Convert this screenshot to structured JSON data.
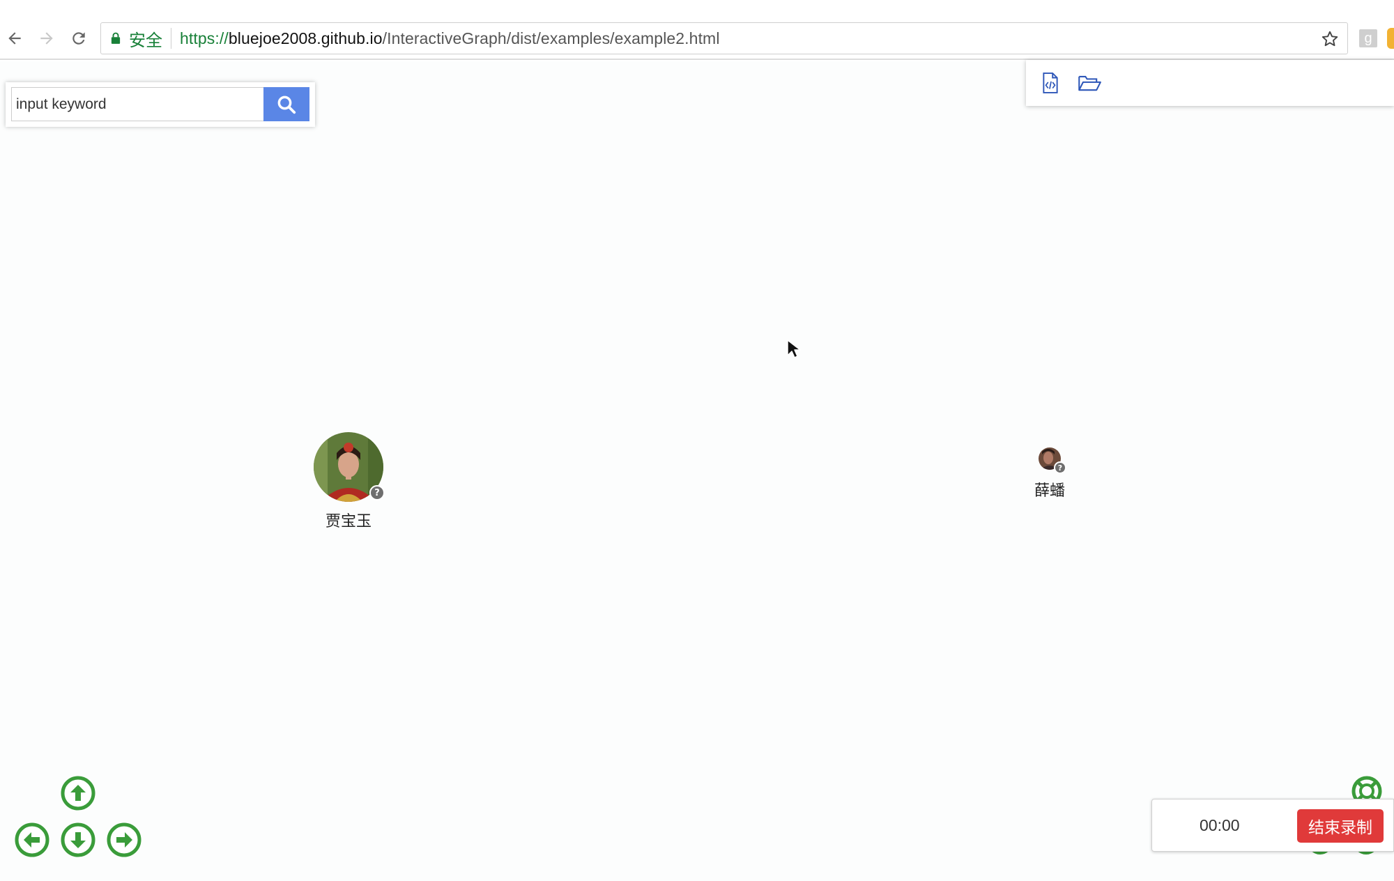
{
  "browser": {
    "back_icon": "back-arrow-icon",
    "forward_icon": "forward-arrow-icon",
    "reload_icon": "reload-icon",
    "security_label": "安全",
    "url_scheme": "https://",
    "url_host": "bluejoe2008.github.io",
    "url_path": "/InteractiveGraph/dist/examples/example2.html",
    "bookmark_icon": "star-icon",
    "extension_label": "g"
  },
  "search": {
    "placeholder": "input keyword",
    "value": "",
    "button_icon": "search-icon"
  },
  "toolbar": {
    "items": [
      "export-source-icon",
      "open-folder-icon"
    ]
  },
  "graph": {
    "nodes": [
      {
        "label": "贾宝玉",
        "badge": "?"
      },
      {
        "label": "薛蟠",
        "badge": "?"
      }
    ]
  },
  "controls": {
    "arrows": [
      "up",
      "left",
      "down",
      "right"
    ],
    "accent_color": "#3a9c3a"
  },
  "recording": {
    "timer": "00:00",
    "stop_label": "结束录制",
    "stop_color": "#e03a3a"
  }
}
